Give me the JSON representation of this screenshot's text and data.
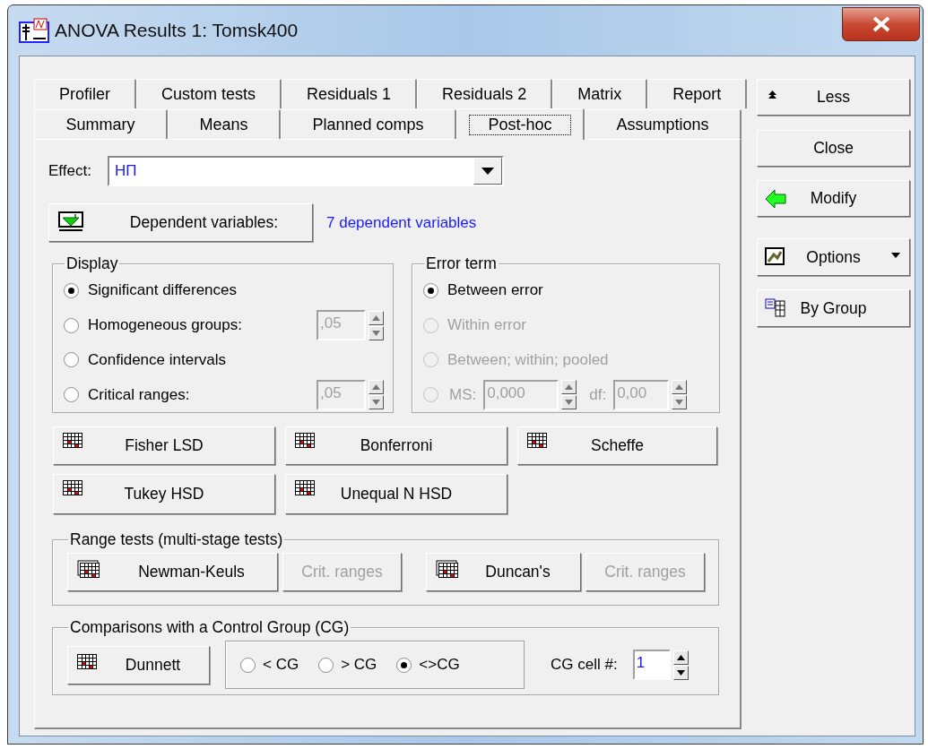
{
  "window": {
    "title": "ANOVA Results 1: Tomsk400"
  },
  "tab_rows": [
    [
      {
        "label": "Profiler",
        "selected": false
      },
      {
        "label": "Custom tests",
        "selected": false
      },
      {
        "label": "Residuals 1",
        "selected": false
      },
      {
        "label": "Residuals 2",
        "selected": false
      },
      {
        "label": "Matrix",
        "selected": false
      },
      {
        "label": "Report",
        "selected": false
      }
    ],
    [
      {
        "label": "Summary",
        "selected": false
      },
      {
        "label": "Means",
        "selected": false
      },
      {
        "label": "Planned comps",
        "selected": false
      },
      {
        "label": "Post-hoc",
        "selected": true
      },
      {
        "label": "Assumptions",
        "selected": false
      }
    ]
  ],
  "effect": {
    "label": "Effect:",
    "value": "НП"
  },
  "dependent": {
    "button": "Dependent variables:",
    "summary": "7 dependent variables"
  },
  "display": {
    "title": "Display",
    "options": [
      {
        "label": "Significant differences",
        "selected": true
      },
      {
        "label": "Homogeneous groups:",
        "selected": false,
        "field": {
          "value": ",05",
          "disabled": true
        }
      },
      {
        "label": "Confidence intervals",
        "selected": false
      },
      {
        "label": "Critical ranges:",
        "selected": false,
        "field": {
          "value": ",05",
          "disabled": true
        }
      }
    ]
  },
  "error_term": {
    "title": "Error term",
    "options": [
      {
        "kind": "text",
        "label": "Between error",
        "selected": true,
        "disabled": false
      },
      {
        "kind": "text",
        "label": "Within error",
        "selected": false,
        "disabled": true
      },
      {
        "kind": "text",
        "label": "Between; within; pooled",
        "selected": false,
        "disabled": true
      },
      {
        "kind": "fields",
        "selected": false,
        "disabled": true,
        "fields": [
          {
            "label": "MS:",
            "value": "0,000"
          },
          {
            "label": "df:",
            "value": "0,00"
          }
        ]
      }
    ]
  },
  "test_buttons": [
    [
      {
        "label": "Fisher LSD"
      },
      {
        "label": "Bonferroni"
      },
      {
        "label": "Scheffe"
      }
    ],
    [
      {
        "label": "Tukey HSD"
      },
      {
        "label": "Unequal N HSD"
      }
    ]
  ],
  "range_tests": {
    "title": "Range tests (multi-stage tests)",
    "buttons": [
      {
        "label": "Newman-Keuls",
        "kind": "test",
        "disabled": false
      },
      {
        "label": "Crit. ranges",
        "kind": "plain",
        "disabled": true
      },
      {
        "label": "Duncan's",
        "kind": "test",
        "disabled": false
      },
      {
        "label": "Crit. ranges",
        "kind": "plain",
        "disabled": true
      }
    ]
  },
  "comparisons": {
    "title": "Comparisons with a Control Group (CG)",
    "button": "Dunnett",
    "options": [
      {
        "label": "< CG",
        "selected": false
      },
      {
        "label": "> CG",
        "selected": false
      },
      {
        "label": "<>CG",
        "selected": true
      }
    ],
    "cell_label": "CG cell #:",
    "cell_value": "1"
  },
  "side_buttons": [
    {
      "label": "Less",
      "kind": "less"
    },
    {
      "label": "Close",
      "kind": "plain"
    },
    {
      "label": "Modify",
      "kind": "modify"
    },
    {
      "label": "Options",
      "kind": "options"
    },
    {
      "label": "By Group",
      "kind": "group"
    }
  ]
}
